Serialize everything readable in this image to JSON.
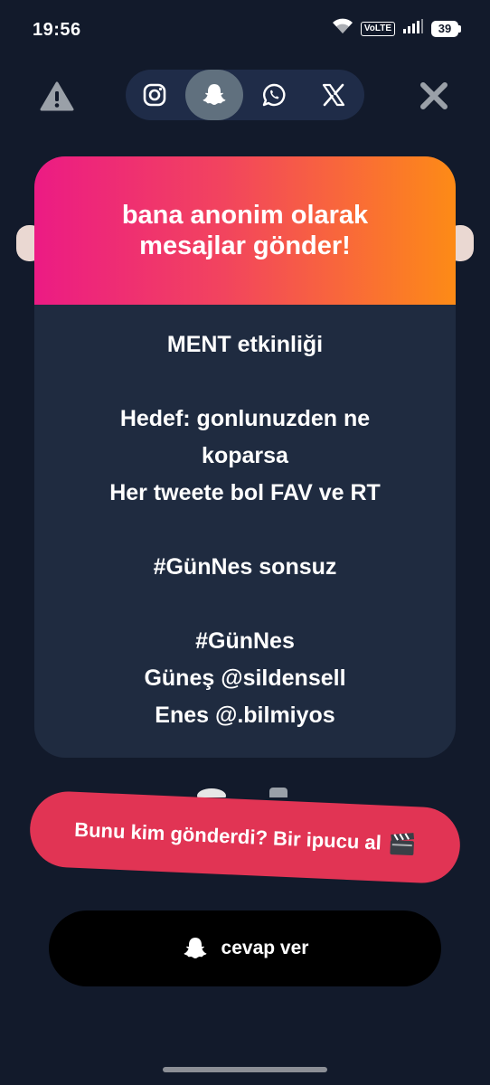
{
  "status_bar": {
    "time": "19:56",
    "volte": "VoLTE",
    "battery": "39",
    "icons": [
      "wifi-icon",
      "signal-icon",
      "battery-icon"
    ]
  },
  "top_bar": {
    "left_icon": "warning-icon",
    "right_icon": "close-icon",
    "share_targets": [
      {
        "icon": "instagram-icon",
        "active": false
      },
      {
        "icon": "snapchat-icon",
        "active": true
      },
      {
        "icon": "whatsapp-icon",
        "active": false
      },
      {
        "icon": "x-twitter-icon",
        "active": false
      }
    ]
  },
  "card": {
    "header": "bana anonim olarak\nmesajlar gönder!",
    "message": "MENT etkinliği\n\nHedef: gonlunuzden ne\nkoparsa\nHer tweete bol FAV ve RT\n\n#GünNes sonsuz\n\n#GünNes\nGüneş @sildensell\nEnes @.bilmiyos"
  },
  "hint_button": {
    "label": "Bunu kim gönderdi? Bir ipucu al",
    "icon": "clapper-board-icon"
  },
  "reply_button": {
    "label": "cevap ver",
    "icon": "snapchat-icon"
  },
  "colors": {
    "background": "#121a2b",
    "card_body": "#1f2b40",
    "gradient_start": "#ec1b84",
    "gradient_end": "#fd8b16",
    "hint_button": "#e13454",
    "reply_button": "#000000"
  }
}
